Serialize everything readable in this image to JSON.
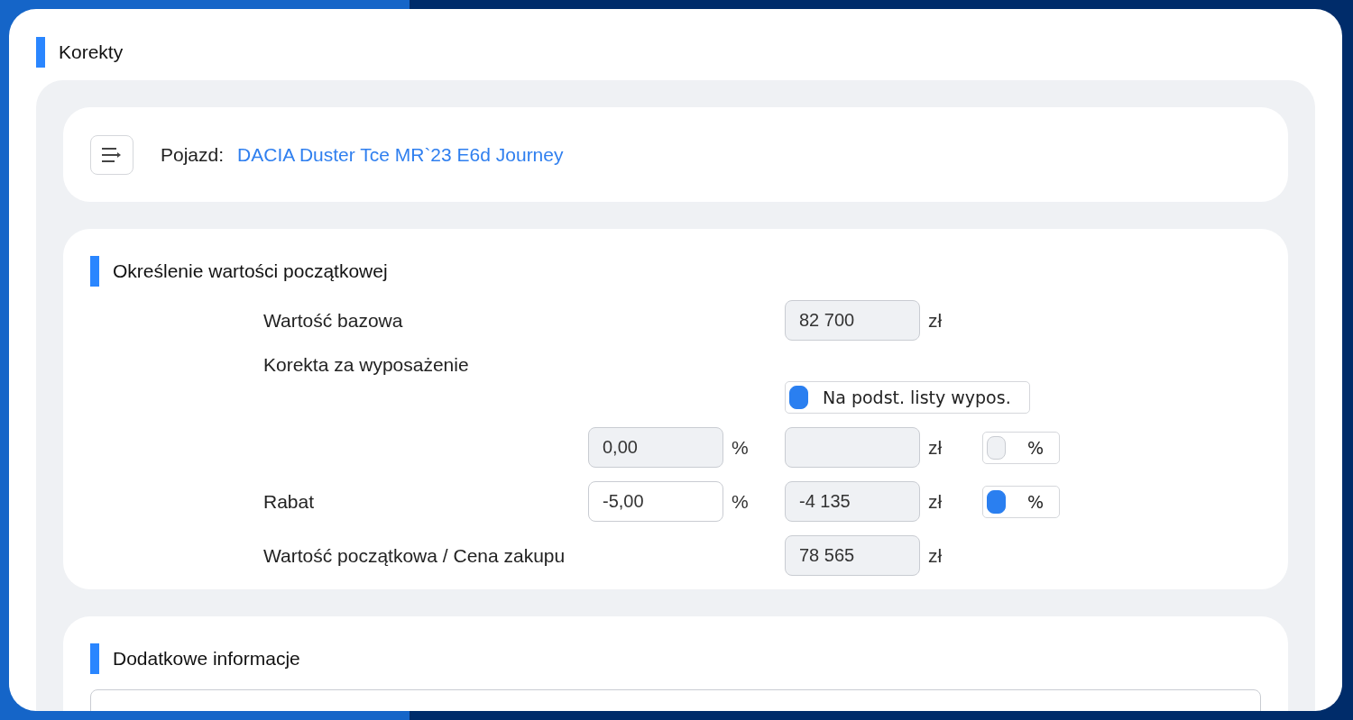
{
  "page_title": "Korekty",
  "vehicle": {
    "label": "Pojazd:",
    "name": "DACIA Duster Tce MR`23 E6d Journey"
  },
  "valuation": {
    "title": "Określenie wartości początkowej",
    "rows": [
      {
        "label": "Wartość bazowa",
        "amount": {
          "value": "82 700",
          "readonly": true,
          "unit": "zł"
        }
      },
      {
        "label": "Korekta za wyposażenie",
        "toggle": {
          "label": "Na podst. listy wypos.",
          "checked": true
        }
      },
      {
        "percent": {
          "value": "0,00",
          "readonly": true,
          "unit": "%"
        },
        "amount": {
          "readonly": true,
          "unit": "zł"
        },
        "toggle": {
          "label": "%",
          "checked": false
        }
      },
      {
        "label": "Rabat",
        "percent": {
          "value": "-5,00",
          "readonly": false,
          "unit": "%"
        },
        "amount": {
          "value": "-4 135",
          "readonly": true,
          "unit": "zł"
        },
        "toggle": {
          "label": "%",
          "checked": true
        }
      },
      {
        "label": "Wartość początkowa / Cena zakupu",
        "amount": {
          "value": "78 565",
          "readonly": true,
          "unit": "zł"
        }
      }
    ]
  },
  "additional": {
    "title": "Dodatkowe informacje"
  }
}
